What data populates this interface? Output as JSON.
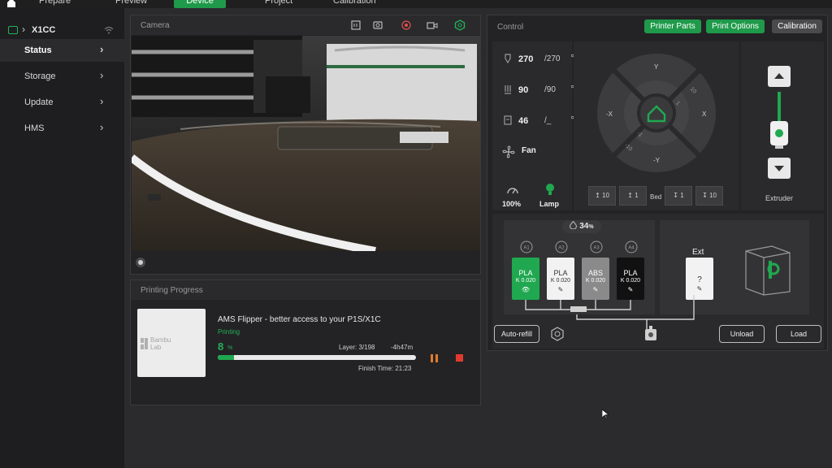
{
  "topbar": {
    "tabs": [
      {
        "label": "Prepare"
      },
      {
        "label": "Preview"
      },
      {
        "label": "Device"
      },
      {
        "label": "Project"
      },
      {
        "label": "Calibration"
      }
    ]
  },
  "sidebar": {
    "device_name": "X1CC",
    "items": [
      {
        "label": "Status",
        "active": true
      },
      {
        "label": "Storage"
      },
      {
        "label": "Update"
      },
      {
        "label": "HMS"
      }
    ]
  },
  "camera": {
    "title": "Camera"
  },
  "progress": {
    "title": "Printing Progress",
    "thumb_logo_1": "Bambu",
    "thumb_logo_2": "Lab",
    "job_title": "AMS Flipper - better access to your P1S/X1C",
    "status": "Printing",
    "percent": "8",
    "percent_unit": "%",
    "percent_value": 8,
    "layer": "Layer: 3/198",
    "remaining": "-4h47m",
    "finish_time": "Finish Time: 21:23"
  },
  "control": {
    "title": "Control",
    "buttons": {
      "printer_parts": "Printer Parts",
      "print_options": "Print Options",
      "calibration": "Calibration"
    },
    "temps": [
      {
        "value": "270",
        "target": "/270",
        "unit": "℃"
      },
      {
        "value": "90",
        "target": "/90",
        "unit": "℃"
      },
      {
        "value": "46",
        "target": "/_",
        "unit": "℃"
      }
    ],
    "fan_label": "Fan",
    "speed_label": "100%",
    "lamp_label": "Lamp",
    "jog": {
      "y_plus": "Y",
      "y_minus": "-Y",
      "x_plus": "X",
      "x_minus": "-X",
      "step_10": "10",
      "step_1": "1",
      "step_neg1": "-1",
      "step_neg10": "-10"
    },
    "bed": {
      "label": "Bed",
      "up10": "10",
      "up1": "1",
      "down1": "1",
      "down10": "10"
    },
    "extruder_label": "Extruder"
  },
  "ams": {
    "humidity": "34",
    "humidity_unit": "%",
    "slots": [
      {
        "id": "A1",
        "type": "PLA",
        "k": "K 0.020",
        "color": "#1fa84f",
        "text": "#ffffff"
      },
      {
        "id": "A2",
        "type": "PLA",
        "k": "K 0.020",
        "color": "#f2f2f2",
        "text": "#333333"
      },
      {
        "id": "A3",
        "type": "ABS",
        "k": "K 0.020",
        "color": "#8a8a8a",
        "text": "#ffffff"
      },
      {
        "id": "A4",
        "type": "PLA",
        "k": "K 0.020",
        "color": "#111111",
        "text": "#ffffff"
      }
    ],
    "ext_title": "Ext",
    "ext_slot": "?",
    "auto_refill": "Auto-refill",
    "unload": "Unload",
    "load": "Load"
  }
}
